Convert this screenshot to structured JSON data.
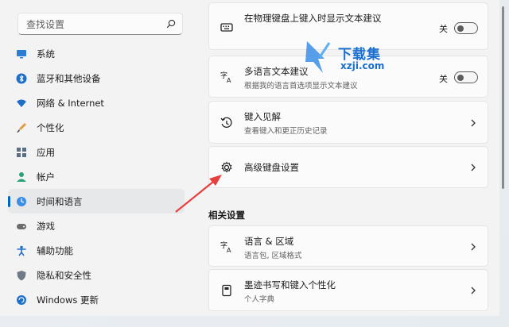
{
  "search": {
    "placeholder": "查找设置"
  },
  "sidebar": {
    "items": [
      {
        "label": "系统",
        "icon": "monitor-icon"
      },
      {
        "label": "蓝牙和其他设备",
        "icon": "bluetooth-icon"
      },
      {
        "label": "网络 & Internet",
        "icon": "wifi-icon"
      },
      {
        "label": "个性化",
        "icon": "brush-icon"
      },
      {
        "label": "应用",
        "icon": "apps-icon"
      },
      {
        "label": "帐户",
        "icon": "person-icon"
      },
      {
        "label": "时间和语言",
        "icon": "globe-clock-icon",
        "active": true
      },
      {
        "label": "游戏",
        "icon": "gamepad-icon"
      },
      {
        "label": "辅助功能",
        "icon": "accessibility-icon"
      },
      {
        "label": "隐私和安全性",
        "icon": "shield-icon"
      },
      {
        "label": "Windows 更新",
        "icon": "update-icon"
      }
    ]
  },
  "cards": {
    "physical_keyboard": {
      "title": "在物理键盘上键入时显示文本建议",
      "toggle_label": "关"
    },
    "multilingual": {
      "title": "多语言文本建议",
      "subtitle": "根据我的语言首选项显示文本建议",
      "toggle_label": "关"
    },
    "typing_insights": {
      "title": "键入见解",
      "subtitle": "查看键入和更正历史记录"
    },
    "advanced_keyboard": {
      "title": "高级键盘设置"
    }
  },
  "related": {
    "heading": "相关设置",
    "items": [
      {
        "title": "语言 & 区域",
        "subtitle": "语言包, 区域格式"
      },
      {
        "title": "墨迹书写和键入个性化",
        "subtitle": "个人字典"
      }
    ]
  },
  "watermark": {
    "brand": "下载集",
    "url": "xzji.com"
  },
  "colors": {
    "accent": "#0067c0",
    "arrow": "#e8403f",
    "watermark": "#1a6fd1"
  }
}
